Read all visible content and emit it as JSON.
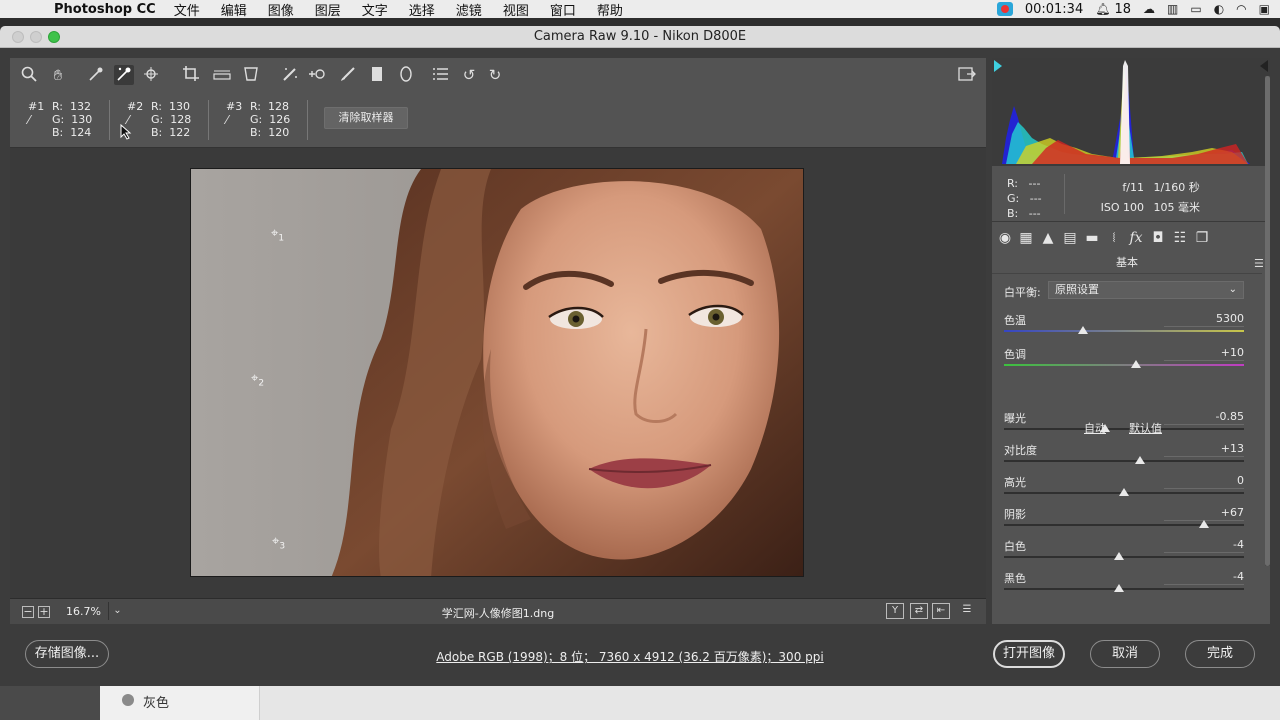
{
  "menubar": {
    "app_name": "Photoshop CC",
    "items": [
      "文件",
      "编辑",
      "图像",
      "图层",
      "文字",
      "选择",
      "滤镜",
      "视图",
      "窗口",
      "帮助"
    ],
    "recording_time": "00:01:34",
    "notification_count": "18"
  },
  "window": {
    "title": "Camera Raw 9.10 -  Nikon D800E"
  },
  "samplers": [
    {
      "num": "#1",
      "rgb": "R:  132\nG:  130\nB:  124"
    },
    {
      "num": "#2",
      "rgb": "R:  130\nG:  128\nB:  122"
    },
    {
      "num": "#3",
      "rgb": "R:  128\nG:  126\nB:  120"
    }
  ],
  "clear_samplers_label": "清除取样器",
  "sample_points": [
    {
      "label": "1"
    },
    {
      "label": "2"
    },
    {
      "label": "3"
    }
  ],
  "canvas_bar": {
    "zoom": "16.7%",
    "filename": "学汇网-人像修图1.dng"
  },
  "readout": {
    "rgb": "R:   ---\nG:   ---\nB:   ---",
    "aperture": "f/11",
    "shutter": "1/160 秒",
    "iso": "ISO 100",
    "focal": "105 毫米"
  },
  "panel": {
    "title": "基本",
    "white_balance_label": "白平衡:",
    "white_balance_value": "原照设置",
    "auto_label": "自动",
    "default_label": "默认值",
    "sliders": [
      {
        "label": "色温",
        "value": "5300",
        "level": 0.33
      },
      {
        "label": "色调",
        "value": "+10",
        "level": 0.55
      },
      {
        "label": "曝光",
        "value": "-0.85",
        "level": 0.42
      },
      {
        "label": "对比度",
        "value": "+13",
        "level": 0.565
      },
      {
        "label": "高光",
        "value": "0",
        "level": 0.5
      },
      {
        "label": "阴影",
        "value": "+67",
        "level": 0.835
      },
      {
        "label": "白色",
        "value": "-4",
        "level": 0.48
      },
      {
        "label": "黑色",
        "value": "-4",
        "level": 0.48
      }
    ]
  },
  "footer": {
    "save_label": "存储图像...",
    "workflow_info": "Adobe RGB (1998)；8 位； 7360 x 4912 (36.2 百万像素)；300 ppi",
    "open_label": "打开图像",
    "cancel_label": "取消",
    "done_label": "完成"
  },
  "backdrop_label": "灰色"
}
